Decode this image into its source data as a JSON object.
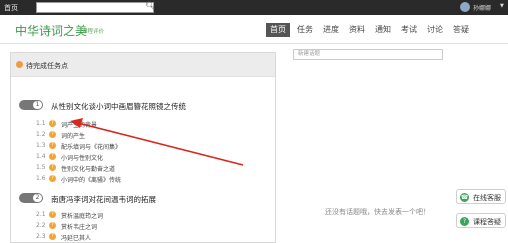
{
  "topbar": {
    "home": "首页",
    "user_name": "孙娜娜"
  },
  "header": {
    "course_title": "中华诗词之美",
    "course_sub": "课程评价",
    "nav": [
      {
        "label": "首页",
        "active": true
      },
      {
        "label": "任务",
        "active": false
      },
      {
        "label": "进度",
        "active": false
      },
      {
        "label": "资料",
        "active": false
      },
      {
        "label": "通知",
        "active": false
      },
      {
        "label": "考试",
        "active": false
      },
      {
        "label": "讨论",
        "active": false
      },
      {
        "label": "答疑",
        "active": false
      }
    ]
  },
  "tasks": {
    "heading": "待完成任务点",
    "chapters": [
      {
        "num": "1",
        "title": "从性别文化谈小词中画眉簪花照镜之传统",
        "lessons": [
          {
            "num": "1.1",
            "title": "词产生的背景"
          },
          {
            "num": "1.2",
            "title": "词的产生"
          },
          {
            "num": "1.3",
            "title": "配乐填词与《花间集》"
          },
          {
            "num": "1.4",
            "title": "小词与性别文化"
          },
          {
            "num": "1.5",
            "title": "性别文化与勤奋之道"
          },
          {
            "num": "1.6",
            "title": "小词中的《离骚》传统"
          }
        ]
      },
      {
        "num": "2",
        "title": "南唐冯李词对花间温韦词的拓展",
        "lessons": [
          {
            "num": "2.1",
            "title": "赏析温庭筠之词"
          },
          {
            "num": "2.2",
            "title": "赏析韦庄之词"
          },
          {
            "num": "2.3",
            "title": "冯延巳其人"
          }
        ]
      }
    ]
  },
  "discussion": {
    "new_topic_placeholder": "新建话题",
    "empty_text": "还没有话题哦，快去发表一个吧！"
  },
  "side_buttons": {
    "online_service": "在线客服",
    "course_qa": "课程答疑"
  },
  "colors": {
    "accent_green": "#3a9a4a",
    "orange": "#f2a535",
    "arrow_red": "#d9261c"
  }
}
